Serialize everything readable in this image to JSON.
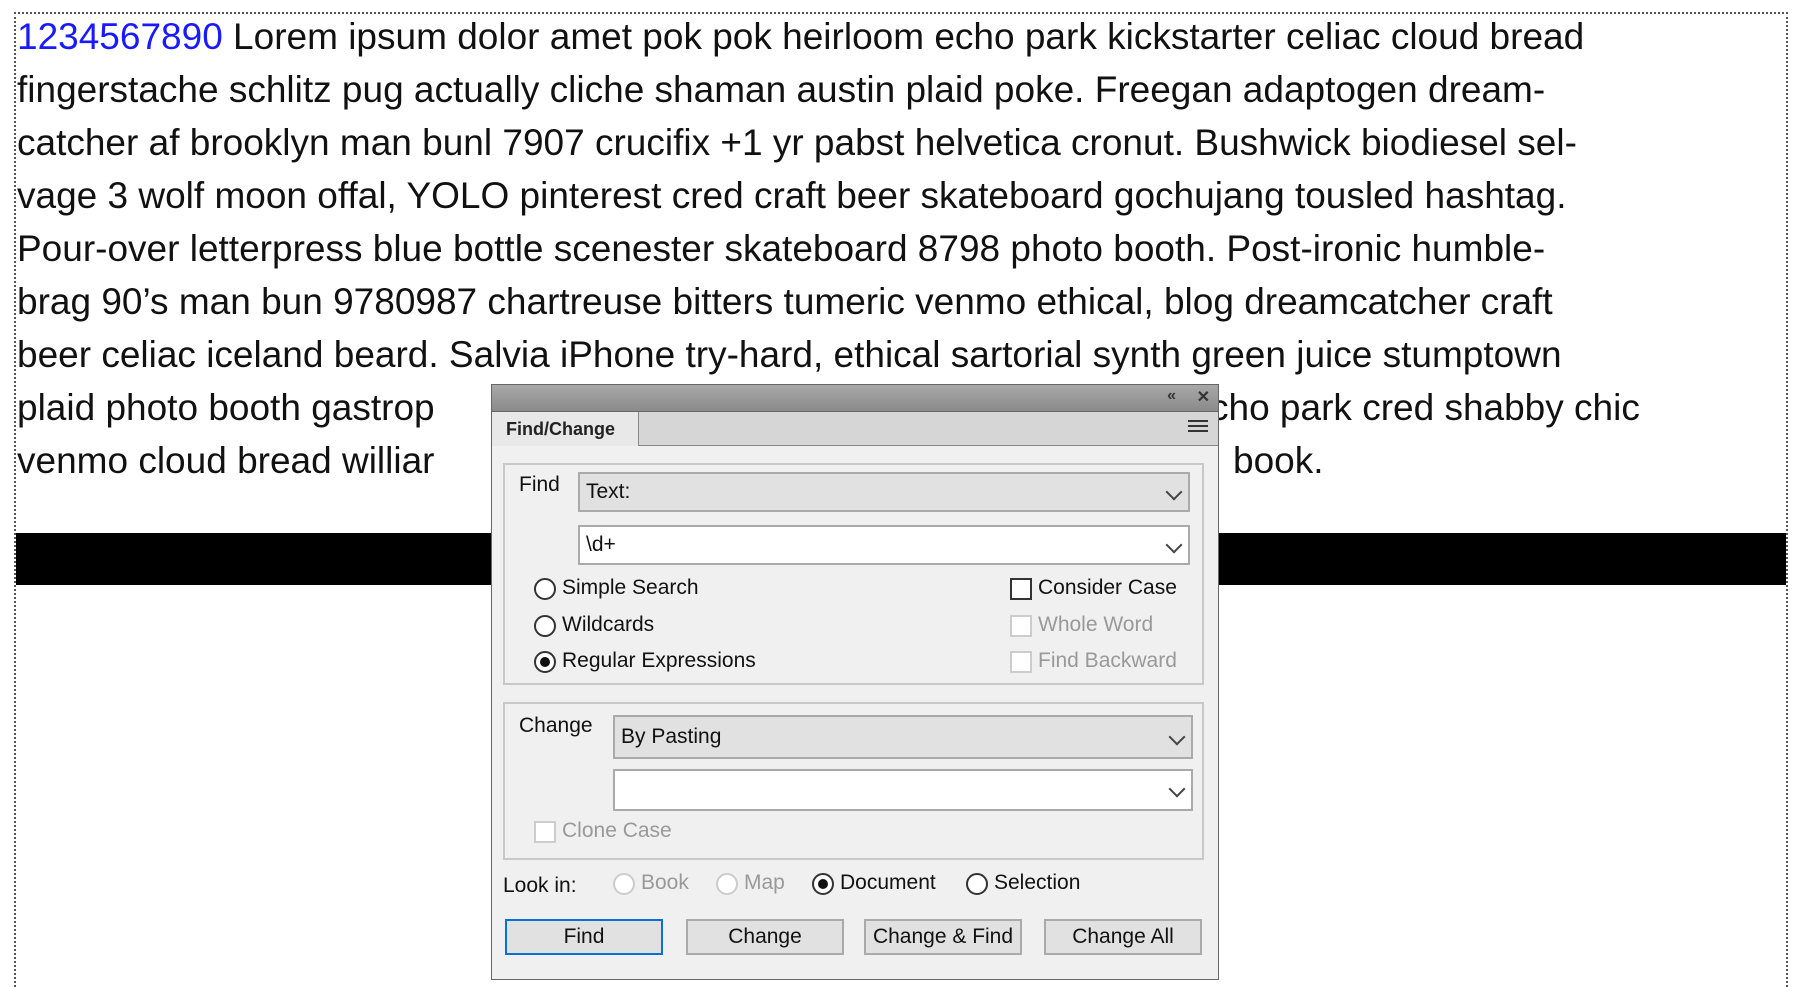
{
  "story": {
    "lines": [
      {
        "num": "1234567890",
        "text": " Lorem ipsum dolor amet pok pok heirloom echo park kickstarter celiac cloud bread"
      },
      {
        "text": "fingerstache schlitz pug actually cliche shaman austin plaid poke. Freegan adaptogen dream-"
      },
      {
        "text": "catcher af brooklyn man bunl 7907  crucifix +1 yr pabst helvetica cronut. Bushwick biodiesel sel-"
      },
      {
        "text": "vage 3 wolf moon offal, YOLO pinterest cred craft beer skateboard gochujang tousled hashtag."
      },
      {
        "text": "Pour-over letterpress blue bottle scenester skateboard 8798 photo booth. Post-ironic humble-"
      },
      {
        "text": "brag 90’s man bun 9780987 chartreuse bitters tumeric venmo ethical, blog dreamcatcher craft"
      },
      {
        "text": "beer celiac iceland beard. Salvia iPhone try-hard, ethical sartorial synth green juice stumptown"
      },
      {
        "text": "plaid photo booth gastrop",
        "tail": "cho park cred shabby chic"
      },
      {
        "text": "venmo cloud bread williar",
        "tail": "book."
      }
    ],
    "highlight_color": "#1a1aff"
  },
  "dialog": {
    "collapse_icon": "double-chevron-left-icon",
    "close_icon": "close-icon",
    "tab_label": "Find/Change",
    "menu_icon": "hamburger-menu-icon",
    "find": {
      "label": "Find",
      "type_value": "Text:",
      "query_value": "\\d+",
      "modes": [
        {
          "label": "Simple Search",
          "selected": false
        },
        {
          "label": "Wildcards",
          "selected": false
        },
        {
          "label": "Regular Expressions",
          "selected": true
        }
      ],
      "options": [
        {
          "label": "Consider Case",
          "checked": false,
          "enabled": true
        },
        {
          "label": "Whole Word",
          "checked": false,
          "enabled": false
        },
        {
          "label": "Find Backward",
          "checked": false,
          "enabled": false
        }
      ]
    },
    "change": {
      "label": "Change",
      "type_value": "By Pasting",
      "replace_value": "",
      "clone_case": {
        "label": "Clone Case",
        "checked": false,
        "enabled": false
      }
    },
    "look_in": {
      "label": "Look in:",
      "options": [
        {
          "label": "Book",
          "selected": false,
          "enabled": false
        },
        {
          "label": "Map",
          "selected": false,
          "enabled": false
        },
        {
          "label": "Document",
          "selected": true,
          "enabled": true
        },
        {
          "label": "Selection",
          "selected": false,
          "enabled": true
        }
      ]
    },
    "buttons": {
      "find": "Find",
      "change": "Change",
      "change_find": "Change & Find",
      "change_all": "Change All"
    },
    "accent_color": "#0a6fd6"
  }
}
